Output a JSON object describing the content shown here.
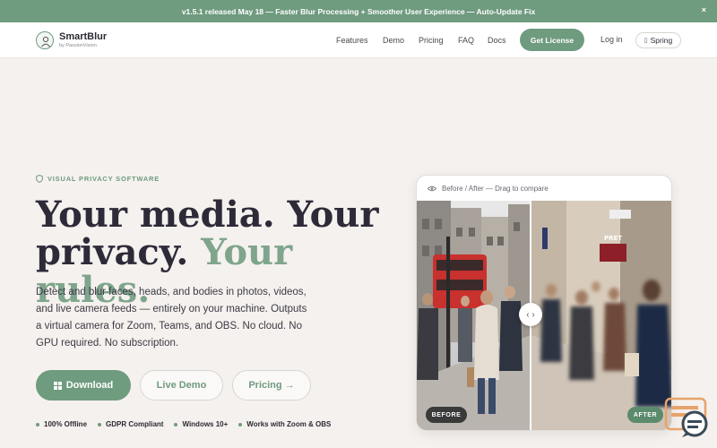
{
  "announcement": {
    "text": "v1.5.1 released May 18 — Faster Blur Processing + Smoother User Experience — Auto-Update Fix",
    "close": "×"
  },
  "header": {
    "brand_name": "SmartBlur",
    "brand_by": "by PassionVision",
    "nav": [
      "Features",
      "Demo",
      "Pricing",
      "FAQ",
      "Docs"
    ],
    "cta": "Get License",
    "login": "Log in",
    "theme": "Spring"
  },
  "hero": {
    "eyebrow": "VISUAL PRIVACY SOFTWARE",
    "headline_1": "Your media. Your",
    "headline_2": "privacy.",
    "headline_accent": "Your rules.",
    "subcopy": "Detect and blur faces, heads, and bodies in photos, videos, and live camera feeds — entirely on your machine. Outputs a virtual camera for Zoom, Teams, and OBS. No cloud. No GPU required. No subscription.",
    "buttons": {
      "download": "Download",
      "demo": "Live Demo",
      "pricing": "Pricing →"
    },
    "badges": [
      "100% Offline",
      "GDPR Compliant",
      "Windows 10+",
      "Works with Zoom & OBS"
    ]
  },
  "compare": {
    "caption": "Before / After — Drag to compare",
    "before": "BEFORE",
    "after": "AFTER",
    "store_sign": "PRET"
  },
  "colors": {
    "accent": "#6f9b7f",
    "headline": "#2e2a38",
    "accent_text": "#7fa58c"
  }
}
